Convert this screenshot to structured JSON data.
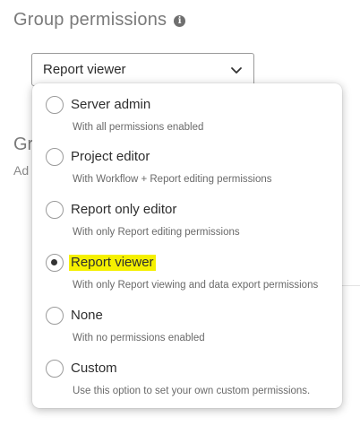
{
  "header": {
    "title": "Group permissions",
    "info_icon": "info-icon"
  },
  "select": {
    "value": "Report viewer",
    "icon": "chevron-down-icon"
  },
  "background": {
    "heading_fragment": "Gr",
    "sub_fragment": "Ad"
  },
  "colors": {
    "highlight": "#f5f000",
    "radio_border": "#9b9b9b"
  },
  "options": [
    {
      "label": "Server admin",
      "description": "With all permissions enabled",
      "selected": false
    },
    {
      "label": "Project editor",
      "description": "With Workflow + Report editing permissions",
      "selected": false
    },
    {
      "label": "Report only editor",
      "description": "With only Report editing permissions",
      "selected": false
    },
    {
      "label": "Report viewer",
      "description": "With only Report viewing and data export permissions",
      "selected": true
    },
    {
      "label": "None",
      "description": "With no permissions enabled",
      "selected": false
    },
    {
      "label": "Custom",
      "description": "Use this option to set your own custom permissions.",
      "selected": false
    }
  ]
}
